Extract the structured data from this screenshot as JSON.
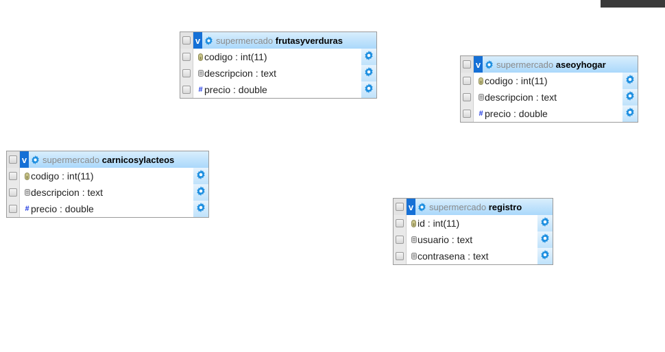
{
  "tables": [
    {
      "database": "supermercado",
      "name": "frutasyverduras",
      "columns": [
        {
          "text": "codigo : int(11)",
          "icon": "key-icon"
        },
        {
          "text": "descripcion : text",
          "icon": "text-field-icon"
        },
        {
          "text": "precio : double",
          "icon": "hash-icon"
        }
      ]
    },
    {
      "database": "supermercado",
      "name": "aseoyhogar",
      "columns": [
        {
          "text": "codigo : int(11)",
          "icon": "key-icon"
        },
        {
          "text": "descripcion : text",
          "icon": "text-field-icon"
        },
        {
          "text": "precio : double",
          "icon": "hash-icon"
        }
      ]
    },
    {
      "database": "supermercado",
      "name": "carnicosylacteos",
      "columns": [
        {
          "text": "codigo : int(11)",
          "icon": "key-icon"
        },
        {
          "text": "descripcion : text",
          "icon": "text-field-icon"
        },
        {
          "text": "precio : double",
          "icon": "hash-icon"
        }
      ]
    },
    {
      "database": "supermercado",
      "name": "registro",
      "columns": [
        {
          "text": "id : int(11)",
          "icon": "key-icon"
        },
        {
          "text": "usuario : text",
          "icon": "text-field-icon"
        },
        {
          "text": "contrasena : text",
          "icon": "text-field-icon"
        }
      ]
    }
  ],
  "toggle_label": "v",
  "hash_glyph": "#"
}
